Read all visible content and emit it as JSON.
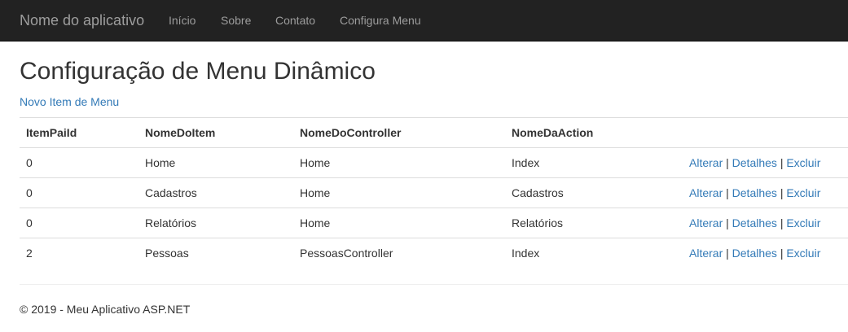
{
  "navbar": {
    "brand": "Nome do aplicativo",
    "links": [
      {
        "label": "Início"
      },
      {
        "label": "Sobre"
      },
      {
        "label": "Contato"
      },
      {
        "label": "Configura Menu"
      }
    ]
  },
  "main": {
    "title": "Configuração de Menu Dinâmico",
    "new_item_link": "Novo Item de Menu",
    "table": {
      "headers": [
        "ItemPaiId",
        "NomeDoItem",
        "NomeDoController",
        "NomeDaAction",
        ""
      ],
      "rows": [
        {
          "item_pai_id": "0",
          "nome_do_item": "Home",
          "nome_do_controller": "Home",
          "nome_da_action": "Index"
        },
        {
          "item_pai_id": "0",
          "nome_do_item": "Cadastros",
          "nome_do_controller": "Home",
          "nome_da_action": "Cadastros"
        },
        {
          "item_pai_id": "0",
          "nome_do_item": "Relatórios",
          "nome_do_controller": "Home",
          "nome_da_action": "Relatórios"
        },
        {
          "item_pai_id": "2",
          "nome_do_item": "Pessoas",
          "nome_do_controller": "PessoasController",
          "nome_da_action": "Index"
        }
      ],
      "actions": {
        "edit": "Alterar",
        "details": "Detalhes",
        "delete": "Excluir",
        "separator": "|"
      }
    }
  },
  "footer": {
    "text": "© 2019 - Meu Aplicativo ASP.NET"
  },
  "colors": {
    "navbar_bg": "#222222",
    "navbar_text": "#9d9d9d",
    "link": "#337ab7",
    "text": "#333333",
    "border": "#dddddd"
  }
}
